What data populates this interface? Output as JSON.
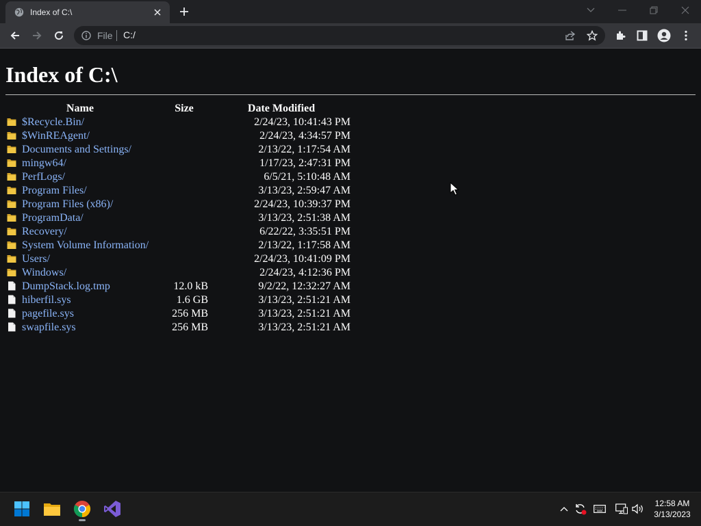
{
  "browser": {
    "tab_title": "Index of C:\\",
    "scheme_label": "File",
    "url": "C:/"
  },
  "page": {
    "heading": "Index of C:\\",
    "columns": [
      "Name",
      "Size",
      "Date Modified"
    ],
    "entries": [
      {
        "type": "folder",
        "name": "$Recycle.Bin/",
        "size": "",
        "modified": "2/24/23, 10:41:43 PM"
      },
      {
        "type": "folder",
        "name": "$WinREAgent/",
        "size": "",
        "modified": "2/24/23, 4:34:57 PM"
      },
      {
        "type": "folder",
        "name": "Documents and Settings/",
        "size": "",
        "modified": "2/13/22, 1:17:54 AM"
      },
      {
        "type": "folder",
        "name": "mingw64/",
        "size": "",
        "modified": "1/17/23, 2:47:31 PM"
      },
      {
        "type": "folder",
        "name": "PerfLogs/",
        "size": "",
        "modified": "6/5/21, 5:10:48 AM"
      },
      {
        "type": "folder",
        "name": "Program Files/",
        "size": "",
        "modified": "3/13/23, 2:59:47 AM"
      },
      {
        "type": "folder",
        "name": "Program Files (x86)/",
        "size": "",
        "modified": "2/24/23, 10:39:37 PM"
      },
      {
        "type": "folder",
        "name": "ProgramData/",
        "size": "",
        "modified": "3/13/23, 2:51:38 AM"
      },
      {
        "type": "folder",
        "name": "Recovery/",
        "size": "",
        "modified": "6/22/22, 3:35:51 PM"
      },
      {
        "type": "folder",
        "name": "System Volume Information/",
        "size": "",
        "modified": "2/13/22, 1:17:58 AM"
      },
      {
        "type": "folder",
        "name": "Users/",
        "size": "",
        "modified": "2/24/23, 10:41:09 PM"
      },
      {
        "type": "folder",
        "name": "Windows/",
        "size": "",
        "modified": "2/24/23, 4:12:36 PM"
      },
      {
        "type": "file",
        "name": "DumpStack.log.tmp",
        "size": "12.0 kB",
        "modified": "9/2/22, 12:32:27 AM"
      },
      {
        "type": "file",
        "name": "hiberfil.sys",
        "size": "1.6 GB",
        "modified": "3/13/23, 2:51:21 AM"
      },
      {
        "type": "file",
        "name": "pagefile.sys",
        "size": "256 MB",
        "modified": "3/13/23, 2:51:21 AM"
      },
      {
        "type": "file",
        "name": "swapfile.sys",
        "size": "256 MB",
        "modified": "3/13/23, 2:51:21 AM"
      }
    ]
  },
  "taskbar": {
    "apps": [
      "windows-start-icon",
      "file-explorer-icon",
      "chrome-icon",
      "visual-studio-icon"
    ],
    "time": "12:58 AM",
    "date": "3/13/2023"
  },
  "colors": {
    "link": "#8ab4f8",
    "folder": "#f0c542",
    "background": "#111214"
  }
}
